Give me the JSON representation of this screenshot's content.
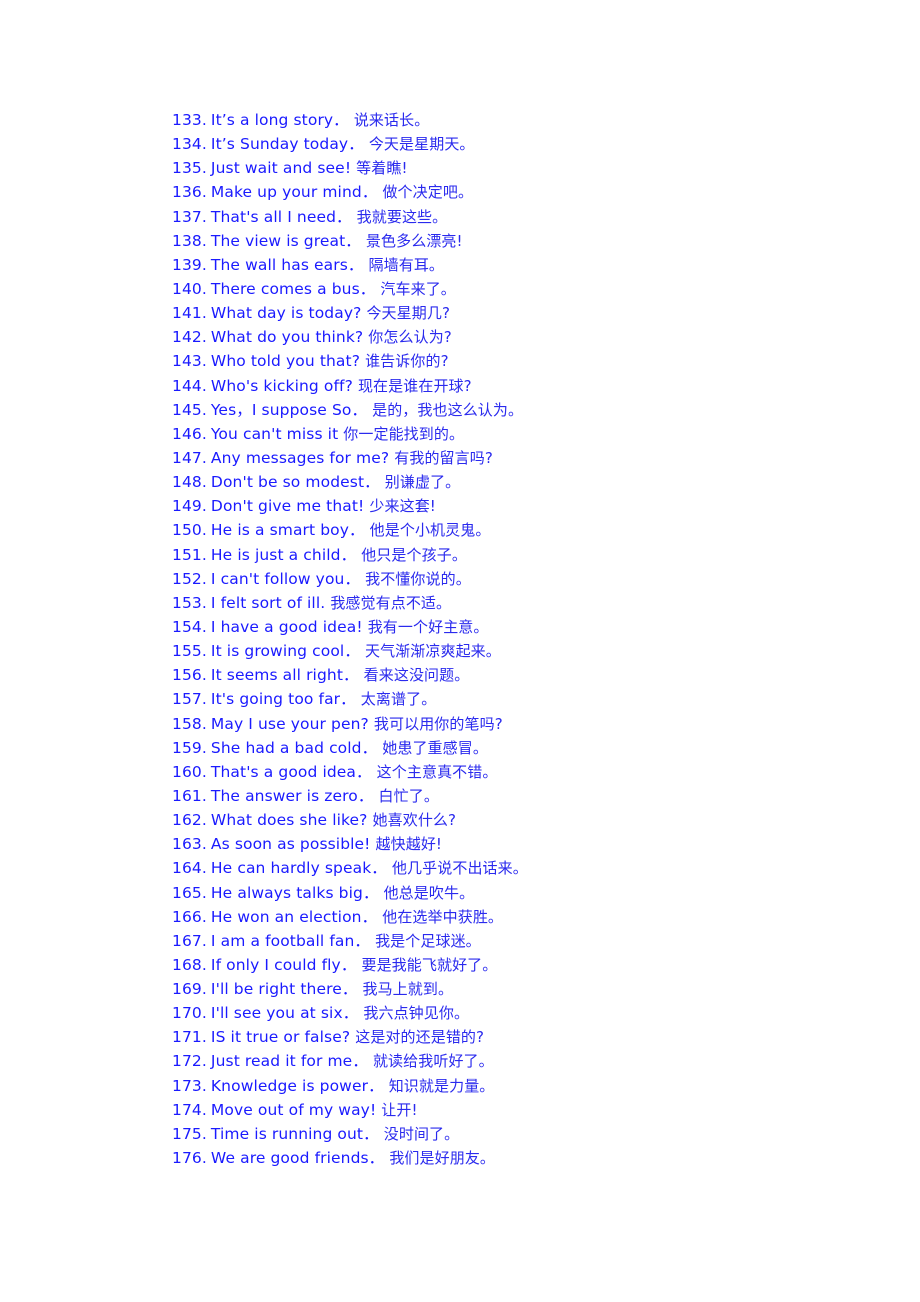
{
  "document": {
    "accent_color": "#1a1aff",
    "phrases": [
      {
        "num": "133.",
        "en": "It’s a long story．",
        "zh": "说来话长。"
      },
      {
        "num": "134.",
        "en": "It’s Sunday today．",
        "zh": "今天是星期天。"
      },
      {
        "num": "135.",
        "en": "Just wait and see!",
        "zh": "等着瞧!"
      },
      {
        "num": "136.",
        "en": "Make up your mind．",
        "zh": "做个决定吧。"
      },
      {
        "num": "137.",
        "en": "That's all I need．",
        "zh": "我就要这些。"
      },
      {
        "num": "138.",
        "en": "The view is great．",
        "zh": "景色多么漂亮!"
      },
      {
        "num": "139.",
        "en": "The wall has ears．",
        "zh": "隔墙有耳。"
      },
      {
        "num": "140.",
        "en": "There comes a bus．",
        "zh": "汽车来了。"
      },
      {
        "num": "141.",
        "en": "What day is today?",
        "zh": "今天星期几?"
      },
      {
        "num": "142.",
        "en": "What do you think?",
        "zh": "你怎么认为?"
      },
      {
        "num": "143.",
        "en": "Who told you that?",
        "zh": "谁告诉你的?"
      },
      {
        "num": "144.",
        "en": "Who's kicking off?",
        "zh": "现在是谁在开球?"
      },
      {
        "num": "145.",
        "en": "Yes，I suppose So．",
        "zh": "是的，我也这么认为。"
      },
      {
        "num": "146.",
        "en": "You can't miss it",
        "zh": "你一定能找到的。"
      },
      {
        "num": "147.",
        "en": "Any messages for me?",
        "zh": "有我的留言吗?"
      },
      {
        "num": "148.",
        "en": "Don't be so modest．",
        "zh": "别谦虚了。"
      },
      {
        "num": "149.",
        "en": "Don't give me that!",
        "zh": "少来这套!"
      },
      {
        "num": "150.",
        "en": "He is a smart boy．",
        "zh": "他是个小机灵鬼。"
      },
      {
        "num": "151.",
        "en": "He is just a child．",
        "zh": "他只是个孩子。"
      },
      {
        "num": "152.",
        "en": "I can't follow you．",
        "zh": "我不懂你说的。"
      },
      {
        "num": "153.",
        "en": "I felt sort of ill.",
        "zh": "我感觉有点不适。"
      },
      {
        "num": "154.",
        "en": "I have a good idea!",
        "zh": "我有一个好主意。"
      },
      {
        "num": "155.",
        "en": "It is growing cool．",
        "zh": "天气渐渐凉爽起来。"
      },
      {
        "num": "156.",
        "en": "It seems all right．",
        "zh": "看来这没问题。"
      },
      {
        "num": "157.",
        "en": "It's going too far．",
        "zh": "太离谱了。"
      },
      {
        "num": "158.",
        "en": "May I use your pen?",
        "zh": "我可以用你的笔吗?"
      },
      {
        "num": "159.",
        "en": "She had a bad cold．",
        "zh": "她患了重感冒。"
      },
      {
        "num": "160.",
        "en": "That's a good idea．",
        "zh": "这个主意真不错。"
      },
      {
        "num": "161.",
        "en": "The answer is zero．",
        "zh": "白忙了。"
      },
      {
        "num": "162.",
        "en": "What does she like?",
        "zh": "她喜欢什么?"
      },
      {
        "num": "163.",
        "en": "As soon as possible!",
        "zh": "越快越好!"
      },
      {
        "num": "164.",
        "en": "He can hardly speak．",
        "zh": "他几乎说不出话来。"
      },
      {
        "num": "165.",
        "en": "He always talks big．",
        "zh": "他总是吹牛。"
      },
      {
        "num": "166.",
        "en": "He won an election．",
        "zh": "他在选举中获胜。"
      },
      {
        "num": "167.",
        "en": "I am a football fan．",
        "zh": "我是个足球迷。"
      },
      {
        "num": "168.",
        "en": "If only I could fly．",
        "zh": "要是我能飞就好了。"
      },
      {
        "num": "169.",
        "en": "I'll be right there．",
        "zh": "我马上就到。"
      },
      {
        "num": "170.",
        "en": "I'll see you at six．",
        "zh": "我六点钟见你。"
      },
      {
        "num": "171.",
        "en": "IS it true or false?",
        "zh": "这是对的还是错的?"
      },
      {
        "num": "172.",
        "en": "Just read it for me．",
        "zh": "就读给我听好了。"
      },
      {
        "num": "173.",
        "en": "Knowledge is power．",
        "zh": "知识就是力量。"
      },
      {
        "num": "174.",
        "en": "Move out of my way!",
        "zh": "让开!"
      },
      {
        "num": "175.",
        "en": "Time is running out．",
        "zh": "没时间了。"
      },
      {
        "num": "176.",
        "en": "We are good friends．",
        "zh": "我们是好朋友。"
      }
    ]
  }
}
